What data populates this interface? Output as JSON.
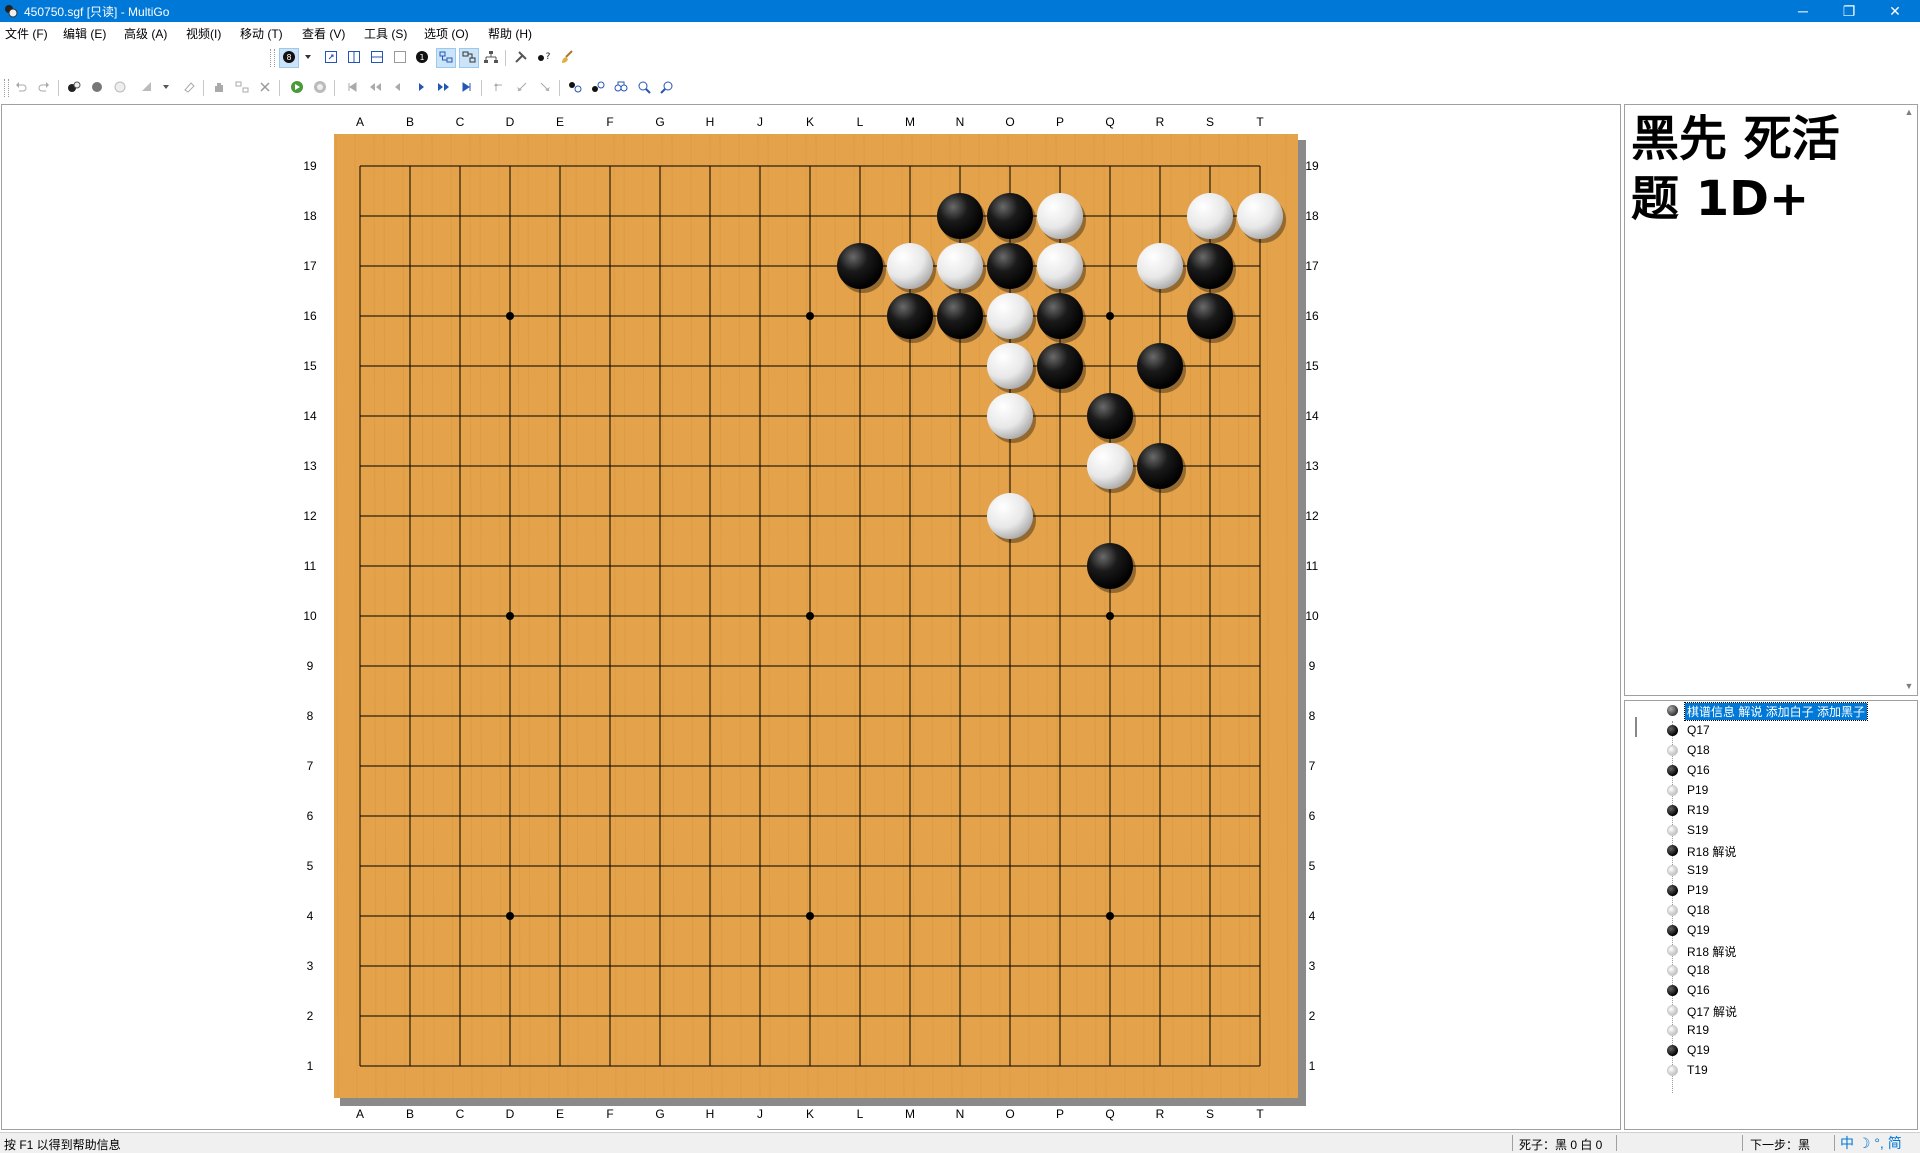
{
  "window": {
    "title": "450750.sgf [只读] - MultiGo",
    "controls": {
      "minimize": "─",
      "restore": "❐",
      "close": "✕"
    }
  },
  "menu": [
    "文件 (F)",
    "编辑 (E)",
    "高级 (A)",
    "视频(I)",
    "移动 (T)",
    "查看 (V)",
    "工具 (S)",
    "选项 (O)",
    "帮助 (H)"
  ],
  "board": {
    "size": 19,
    "columns": [
      "A",
      "B",
      "C",
      "D",
      "E",
      "F",
      "G",
      "H",
      "J",
      "K",
      "L",
      "M",
      "N",
      "O",
      "P",
      "Q",
      "R",
      "S",
      "T"
    ],
    "rows": [
      "19",
      "18",
      "17",
      "16",
      "15",
      "14",
      "13",
      "12",
      "11",
      "10",
      "9",
      "8",
      "7",
      "6",
      "5",
      "4",
      "3",
      "2",
      "1"
    ],
    "star_points": [
      "D16",
      "K16",
      "Q16",
      "D10",
      "K10",
      "Q10",
      "D4",
      "K4",
      "Q4"
    ],
    "black_stones": [
      "N18",
      "O18",
      "L17",
      "O17",
      "S17",
      "M16",
      "N16",
      "P16",
      "S16",
      "P15",
      "R15",
      "Q14",
      "R13",
      "Q11"
    ],
    "white_stones": [
      "P18",
      "S18",
      "T18",
      "M17",
      "N17",
      "P17",
      "R17",
      "O16",
      "O15",
      "O14",
      "Q13",
      "O12"
    ],
    "colors": {
      "board": "#e4a24a",
      "board_edge": "#c9862f",
      "line": "#000000"
    }
  },
  "comment": {
    "text": "黑先 死活题 1D+"
  },
  "tree": {
    "nodes": [
      {
        "color": "root",
        "label": "棋谱信息 解说 添加白子 添加黑子",
        "selected": true
      },
      {
        "color": "black",
        "label": "Q17"
      },
      {
        "color": "white",
        "label": "Q18"
      },
      {
        "color": "black",
        "label": "Q16"
      },
      {
        "color": "white",
        "label": "P19"
      },
      {
        "color": "black",
        "label": "R19"
      },
      {
        "color": "white",
        "label": "S19"
      },
      {
        "color": "black",
        "label": "R18 解说"
      },
      {
        "color": "white",
        "label": "S19"
      },
      {
        "color": "black",
        "label": "P19"
      },
      {
        "color": "white",
        "label": "Q18"
      },
      {
        "color": "black",
        "label": "Q19"
      },
      {
        "color": "white",
        "label": "R18 解说"
      },
      {
        "color": "white",
        "label": "Q18"
      },
      {
        "color": "black",
        "label": "Q16"
      },
      {
        "color": "white",
        "label": "Q17 解说"
      },
      {
        "color": "white",
        "label": "R19"
      },
      {
        "color": "black",
        "label": "Q19"
      },
      {
        "color": "white",
        "label": "T19"
      }
    ]
  },
  "status": {
    "help": "按 F1 以得到帮助信息",
    "dead": "死子：黑 0 白 0",
    "next": "下一步：黑",
    "ime": "中 ☽ °, 简"
  }
}
